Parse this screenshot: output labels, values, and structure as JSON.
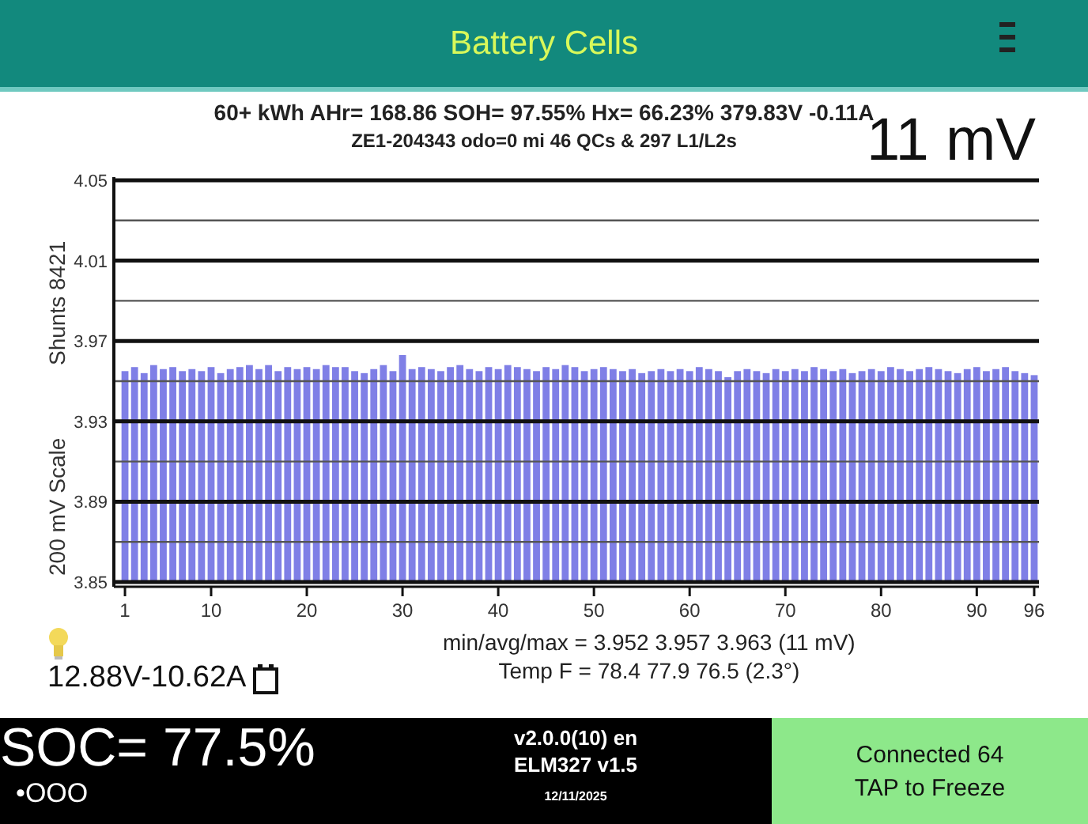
{
  "header": {
    "title": "Battery Cells"
  },
  "summary": [
    "60+ kWh  AHr= 168.86  SOH= 97.55%  Hx= 66.23%  379.83V -0.11A",
    "ZE1-204343 odo=0 mi  46 QCs & 297 L1/L2s"
  ],
  "spread_reading": "11 mV",
  "chart": {
    "chart_data": {
      "type": "bar",
      "ylabel": "200 mV Scale",
      "ylim": [
        3.85,
        4.05
      ],
      "yticks": [
        3.85,
        3.89,
        3.93,
        3.97,
        4.01,
        4.05
      ],
      "grid": true,
      "x": [
        1,
        2,
        3,
        4,
        5,
        6,
        7,
        8,
        9,
        10,
        11,
        12,
        13,
        14,
        15,
        16,
        17,
        18,
        19,
        20,
        21,
        22,
        23,
        24,
        25,
        26,
        27,
        28,
        29,
        30,
        31,
        32,
        33,
        34,
        35,
        36,
        37,
        38,
        39,
        40,
        41,
        42,
        43,
        44,
        45,
        46,
        47,
        48,
        49,
        50,
        51,
        52,
        53,
        54,
        55,
        56,
        57,
        58,
        59,
        60,
        61,
        62,
        63,
        64,
        65,
        66,
        67,
        68,
        69,
        70,
        71,
        72,
        73,
        74,
        75,
        76,
        77,
        78,
        79,
        80,
        81,
        82,
        83,
        84,
        85,
        86,
        87,
        88,
        89,
        90,
        91,
        92,
        93,
        94,
        95,
        96
      ],
      "xticks": [
        1,
        10,
        20,
        30,
        40,
        50,
        60,
        70,
        80,
        90,
        96
      ],
      "xlim": [
        0.5,
        96.5
      ],
      "series": [
        {
          "color": "#7f7fe6",
          "values": [
            3.955,
            3.957,
            3.954,
            3.958,
            3.956,
            3.957,
            3.955,
            3.956,
            3.955,
            3.957,
            3.954,
            3.956,
            3.957,
            3.958,
            3.956,
            3.958,
            3.955,
            3.957,
            3.956,
            3.957,
            3.956,
            3.958,
            3.957,
            3.957,
            3.955,
            3.954,
            3.956,
            3.958,
            3.955,
            3.963,
            3.956,
            3.957,
            3.956,
            3.955,
            3.957,
            3.958,
            3.956,
            3.955,
            3.957,
            3.956,
            3.958,
            3.957,
            3.956,
            3.955,
            3.957,
            3.956,
            3.958,
            3.957,
            3.955,
            3.956,
            3.957,
            3.956,
            3.955,
            3.956,
            3.954,
            3.955,
            3.956,
            3.955,
            3.956,
            3.955,
            3.957,
            3.956,
            3.955,
            3.952,
            3.955,
            3.956,
            3.955,
            3.954,
            3.956,
            3.955,
            3.956,
            3.955,
            3.957,
            3.956,
            3.955,
            3.956,
            3.954,
            3.955,
            3.956,
            3.955,
            3.957,
            3.956,
            3.955,
            3.956,
            3.957,
            3.956,
            3.955,
            3.954,
            3.956,
            3.957,
            3.955,
            3.956,
            3.957,
            3.955,
            3.954,
            3.953
          ]
        }
      ]
    },
    "shunts_label": "Shunts 8421"
  },
  "aux_battery": "12.88V-10.62A",
  "stats": [
    "min/avg/max = 3.952 3.957 3.963  (11 mV)",
    "Temp F = 78.4  77.9  76.5  (2.3°)"
  ],
  "footer": {
    "soc": "SOC= 77.5%",
    "dots": "•OOO",
    "version": "v2.0.0(10) en",
    "adapter": "ELM327 v1.5",
    "date": "12/11/2025",
    "status": "Connected 64",
    "action": "TAP to Freeze"
  }
}
